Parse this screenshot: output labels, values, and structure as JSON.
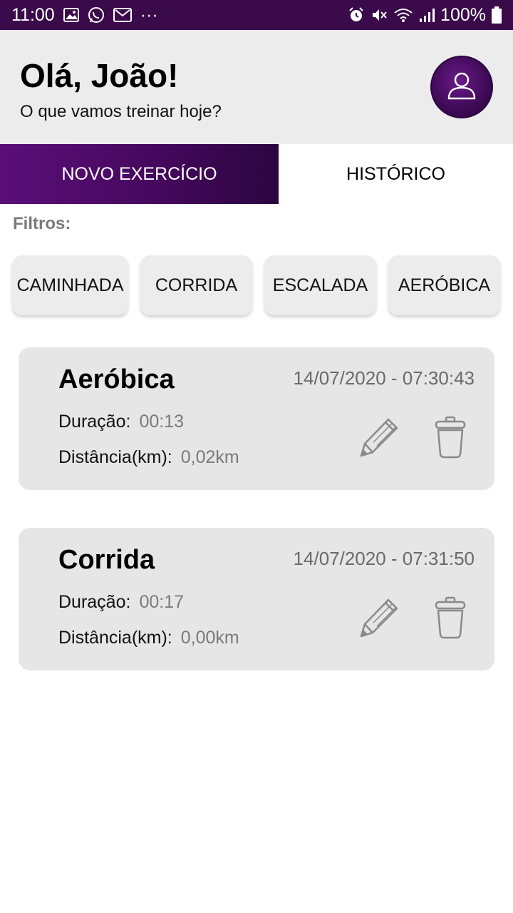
{
  "status_bar": {
    "time": "11:00",
    "overflow": "···",
    "battery": "100%",
    "icons": [
      "image-icon",
      "whatsapp-icon",
      "gmail-icon",
      "alarm-icon",
      "mute-icon",
      "wifi-icon",
      "signal-icon",
      "battery-icon"
    ]
  },
  "header": {
    "greeting": "Olá, João!",
    "subtitle": "O que vamos treinar hoje?",
    "avatar_icon": "user-icon"
  },
  "tabs": [
    {
      "label": "NOVO EXERCÍCIO",
      "active": true
    },
    {
      "label": "HISTÓRICO",
      "active": false
    }
  ],
  "filters": {
    "label": "Filtros:",
    "options": [
      "CAMINHADA",
      "CORRIDA",
      "ESCALADA",
      "AERÓBICA"
    ]
  },
  "history": [
    {
      "title": "Aeróbica",
      "datetime": "14/07/2020 - 07:30:43",
      "duration_label": "Duração:",
      "duration": "00:13",
      "distance_label": "Distância(km):",
      "distance": "0,02km"
    },
    {
      "title": "Corrida",
      "datetime": "14/07/2020 - 07:31:50",
      "duration_label": "Duração:",
      "duration": "00:17",
      "distance_label": "Distância(km):",
      "distance": "0,00km"
    }
  ],
  "colors": {
    "status_bar": "#3a0a4a",
    "accent": "#5a0f78",
    "header_bg": "#ececec",
    "card_bg": "#e6e6e6",
    "muted_text": "#7a7a7a"
  }
}
